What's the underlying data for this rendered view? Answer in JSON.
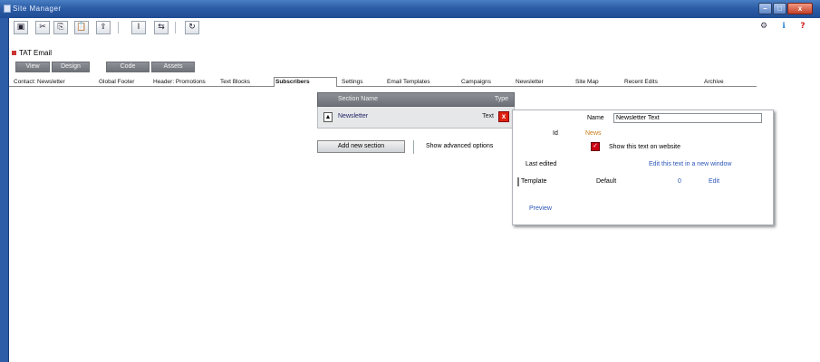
{
  "window": {
    "title": "Site Manager",
    "controls": {
      "minimize": "–",
      "maximize": "□",
      "close": "x"
    }
  },
  "toolbar": {
    "left_buttons": [
      {
        "icon": "save-icon",
        "glyph": "▣"
      },
      {
        "icon": "cut-icon",
        "glyph": "✂"
      },
      {
        "icon": "copy-icon",
        "glyph": "⎘"
      },
      {
        "icon": "paste-icon",
        "glyph": "📋"
      },
      {
        "icon": "upload-icon",
        "glyph": "⇪"
      },
      {
        "icon": "text-cursor-icon",
        "glyph": "I"
      },
      {
        "icon": "link-icon",
        "glyph": "⇆"
      },
      {
        "icon": "refresh-icon",
        "glyph": "↻"
      }
    ],
    "right_buttons": [
      {
        "icon": "settings-icon",
        "glyph": "⚙"
      },
      {
        "icon": "info-icon",
        "glyph": "ℹ"
      },
      {
        "icon": "help-icon",
        "glyph": "?"
      }
    ]
  },
  "path": {
    "label": "TAT Email"
  },
  "view_buttons": [
    "View",
    "Design",
    "Code",
    "Assets"
  ],
  "tabs": {
    "items": [
      "Contact: Newsletter",
      "Global Footer",
      "Header: Promotions",
      "Text Blocks",
      "Subscribers",
      "Settings",
      "Email Templates",
      "Campaigns",
      "Newsletter",
      "Site Map",
      "Recent Edits",
      "Archive"
    ],
    "active_index": 4
  },
  "table": {
    "header": {
      "name": "Section Name",
      "type": "Type"
    },
    "row": {
      "name": "Newsletter",
      "type": "Text",
      "row_icon": "▲",
      "delete_icon": "x"
    }
  },
  "actions": {
    "add_button": "Add new section",
    "text": "Show advanced options"
  },
  "detail": {
    "name_label": "Name",
    "name_value": "Newsletter Text",
    "alias_label": "Id",
    "alias_value": "News",
    "checkbox_label": "Show this text on website",
    "left_label": "Last edited",
    "right_link": "Edit this text in a new window",
    "row4_label": "Template",
    "row4_mid": "Default",
    "row4_num": "0",
    "row4_link": "Edit",
    "bottom_link": "Preview"
  }
}
